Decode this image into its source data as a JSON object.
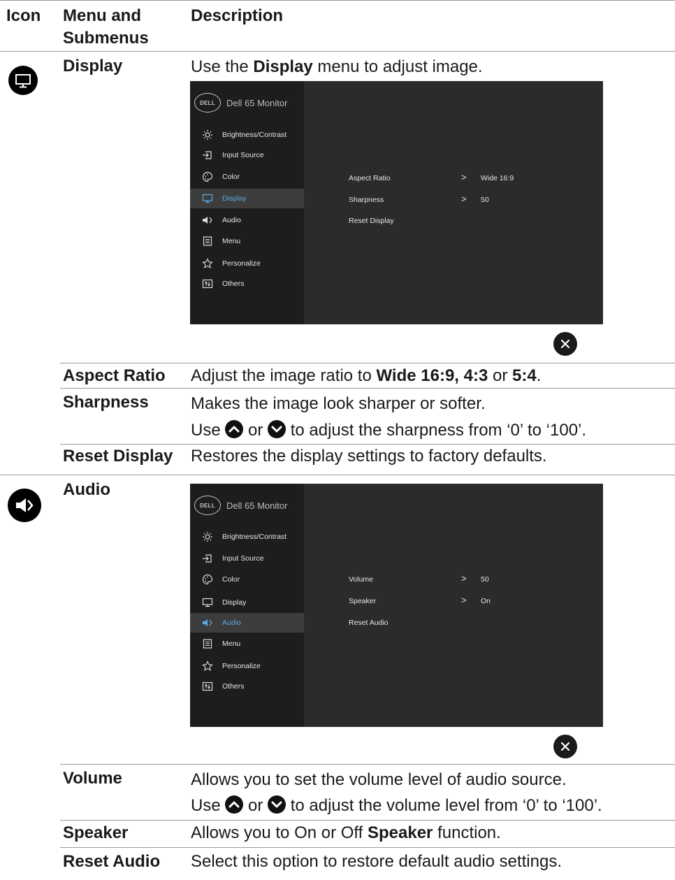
{
  "header": {
    "col_icon": "Icon",
    "col_menu_line1": "Menu and",
    "col_menu_line2": "Submenus",
    "col_desc": "Description"
  },
  "display": {
    "title": "Display",
    "intro_pre": "Use the ",
    "intro_bold": "Display",
    "intro_post": " menu to adjust image.",
    "osd": {
      "brand": "Dell 65 Monitor",
      "menu": [
        "Brightness/Contrast",
        "Input Source",
        "Color",
        "Display",
        "Audio",
        "Menu",
        "Personalize",
        "Others"
      ],
      "options": [
        "Aspect Ratio",
        "Sharpness",
        "Reset Display"
      ],
      "values": [
        "Wide 16:9",
        "50"
      ]
    },
    "rows": {
      "aspect_name": "Aspect Ratio",
      "aspect_pre": "Adjust the image ratio to ",
      "aspect_bold1": "Wide 16:9, 4:3",
      "aspect_mid": " or ",
      "aspect_bold2": "5:4",
      "aspect_post": ".",
      "sharp_name": "Sharpness",
      "sharp_line1": "Makes the image look sharper or softer.",
      "sharp_use": "Use ",
      "sharp_or": " or ",
      "sharp_post": " to adjust the sharpness from ‘0’ to ‘100’.",
      "reset_name": "Reset Display",
      "reset_desc": "Restores the display settings to factory defaults."
    }
  },
  "audio": {
    "title": "Audio",
    "osd": {
      "brand": "Dell 65 Monitor",
      "menu": [
        "Brightness/Contrast",
        "Input Source",
        "Color",
        "Display",
        "Audio",
        "Menu",
        "Personalize",
        "Others"
      ],
      "options": [
        "Volume",
        "Speaker",
        "Reset Audio"
      ],
      "values": [
        "50",
        "On"
      ]
    },
    "rows": {
      "volume_name": "Volume",
      "volume_line1": "Allows you to set the volume level of audio source.",
      "volume_use": "Use ",
      "volume_or": " or ",
      "volume_post": " to adjust the volume level from ‘0’ to ‘100’.",
      "speaker_name": "Speaker",
      "speaker_pre": "Allows you to On or Off ",
      "speaker_bold": "Speaker",
      "speaker_post": " function.",
      "reset_name": "Reset Audio",
      "reset_desc": "Select this option to restore default audio settings."
    }
  },
  "brand_logo": "DELL",
  "icons": [
    "monitor-icon",
    "speaker-icon",
    "close-icon",
    "chevron-up-icon",
    "chevron-down-icon"
  ],
  "colors": {
    "osd_bg": "#2b2b2b",
    "osd_sidebar": "#1d1d1d",
    "osd_active": "#5aa9e6"
  }
}
